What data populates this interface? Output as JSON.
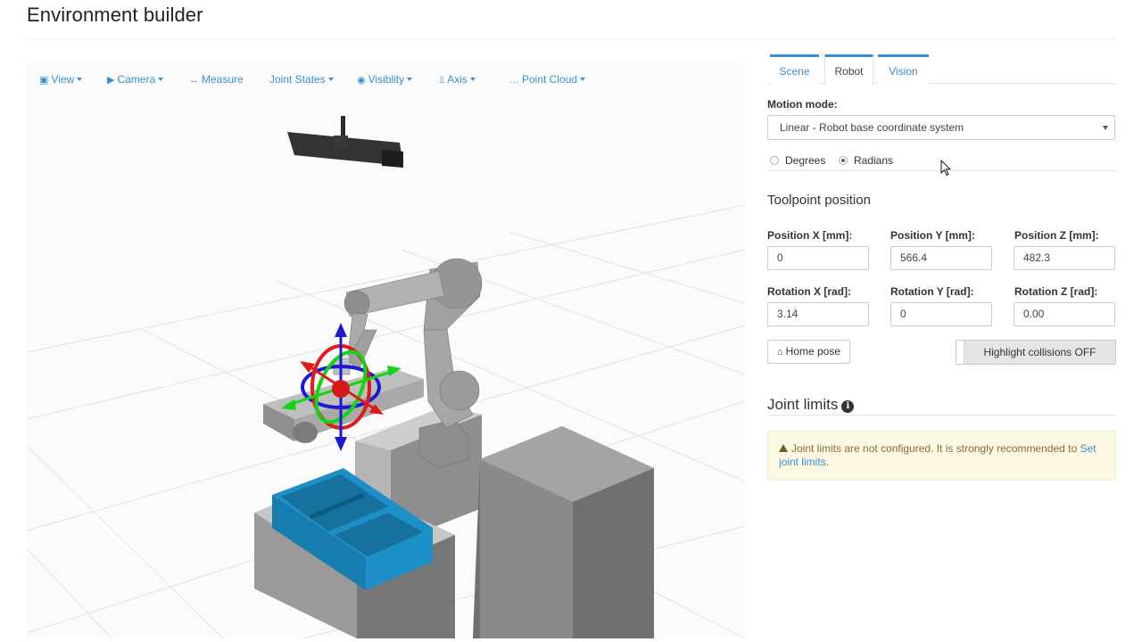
{
  "page": {
    "title": "Environment builder"
  },
  "toolbar": {
    "view": "View",
    "camera": "Camera",
    "measure": "Measure",
    "joint_states": "Joint States",
    "visibility": "Visiblity",
    "axis": "Axis",
    "point_cloud": "Point Cloud"
  },
  "tabs": [
    {
      "label": "Scene",
      "active": false
    },
    {
      "label": "Robot",
      "active": true
    },
    {
      "label": "Vision",
      "active": false
    }
  ],
  "motion": {
    "label": "Motion mode:",
    "selected": "Linear - Robot base coordinate system"
  },
  "units": {
    "degrees": "Degrees",
    "radians": "Radians",
    "selected": "radians"
  },
  "toolpoint": {
    "title": "Toolpoint position",
    "pos_x_label": "Position X [mm]:",
    "pos_y_label": "Position Y [mm]:",
    "pos_z_label": "Position Z [mm]:",
    "rot_x_label": "Rotation X [rad]:",
    "rot_y_label": "Rotation Y [rad]:",
    "rot_z_label": "Rotation Z [rad]:",
    "pos_x": "0",
    "pos_y": "566.4",
    "pos_z": "482.3",
    "rot_x": "3.14",
    "rot_y": "0",
    "rot_z": "0.00"
  },
  "buttons": {
    "home_pose": "Home pose",
    "highlight_collisions": "Highlight collisions OFF"
  },
  "joint_limits": {
    "title": "Joint limits",
    "alert_text": "Joint limits are not configured. It is strongly recommended to",
    "alert_link_1": "Set",
    "alert_link_2": "joint limits",
    "alert_end": "."
  },
  "colors": {
    "accent": "#3a8fd1",
    "warning_bg": "#fcf8e3",
    "warning_text": "#8a6d3b",
    "bin_blue": "#1e8fc6"
  }
}
